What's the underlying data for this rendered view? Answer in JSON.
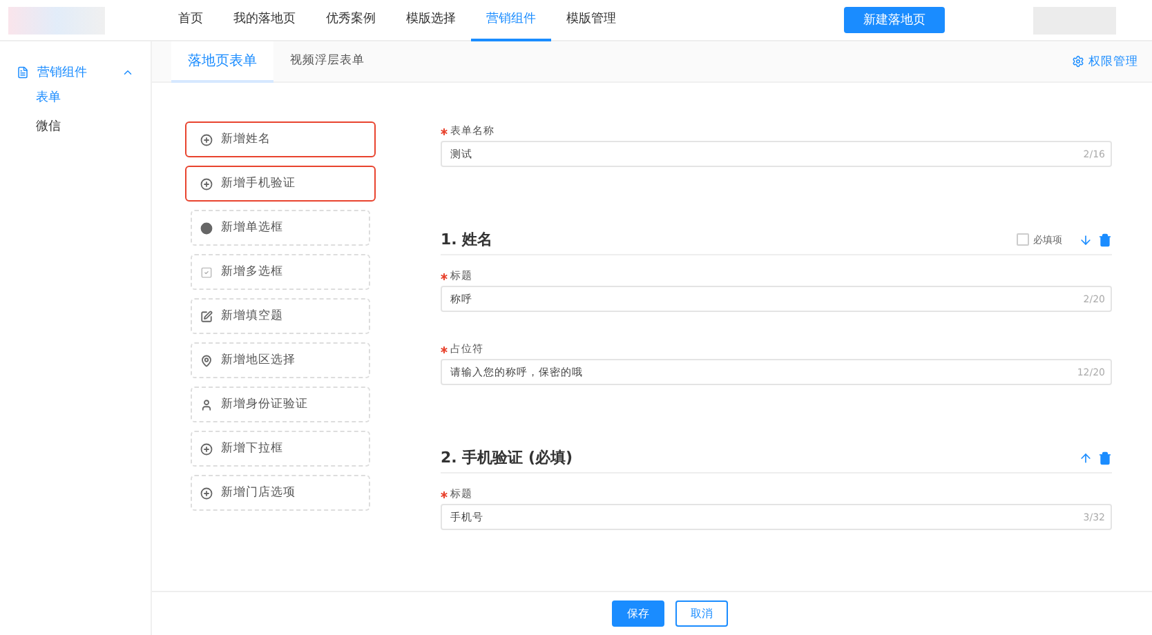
{
  "nav": {
    "items": [
      {
        "label": "首页",
        "selected": false
      },
      {
        "label": "我的落地页",
        "selected": false
      },
      {
        "label": "优秀案例",
        "selected": false
      },
      {
        "label": "模版选择",
        "selected": false
      },
      {
        "label": "营销组件",
        "selected": true
      },
      {
        "label": "模版管理",
        "selected": false
      }
    ],
    "action": "新建落地页"
  },
  "sidebar": {
    "group": {
      "label": "营销组件",
      "expanded": true
    },
    "items": [
      {
        "label": "表单",
        "selected": true
      },
      {
        "label": "微信",
        "selected": false
      }
    ]
  },
  "tabs": [
    {
      "label": "落地页表单",
      "selected": true
    },
    {
      "label": "视频浮层表单",
      "selected": false
    }
  ],
  "permission_link": "权限管理",
  "palette": [
    {
      "kind": "name",
      "label": "新增姓名",
      "highlighted": true
    },
    {
      "kind": "phone",
      "label": "新增手机验证",
      "highlighted": true
    },
    {
      "kind": "radio",
      "label": "新增单选框",
      "highlighted": false
    },
    {
      "kind": "checkbox",
      "label": "新增多选框",
      "highlighted": false
    },
    {
      "kind": "fill",
      "label": "新增填空题",
      "highlighted": false
    },
    {
      "kind": "region",
      "label": "新增地区选择",
      "highlighted": false
    },
    {
      "kind": "id",
      "label": "新增身份证验证",
      "highlighted": false
    },
    {
      "kind": "dropdown",
      "label": "新增下拉框",
      "highlighted": false
    },
    {
      "kind": "store",
      "label": "新增门店选项",
      "highlighted": false
    }
  ],
  "form_name": {
    "label": "表单名称",
    "required": true,
    "value": "测试",
    "counter": "2/16"
  },
  "sections": [
    {
      "title": "1. 姓名",
      "required_option": {
        "label": "必填项",
        "checked": false
      },
      "move_arrow": {
        "kind": "down"
      },
      "fields": [
        {
          "label": "标题",
          "required": true,
          "value": "称呼",
          "counter": "2/20"
        },
        {
          "label": "占位符",
          "required": true,
          "value": "请输入您的称呼，保密的哦",
          "counter": "12/20"
        }
      ]
    },
    {
      "title": "2. 手机验证 (必填)",
      "move_arrow": {
        "kind": "up"
      },
      "fields": [
        {
          "label": "标题",
          "required": true,
          "value": "手机号",
          "counter": "3/32"
        }
      ]
    }
  ],
  "buttons": [
    {
      "kind": "primary",
      "label": "保存"
    },
    {
      "kind": "secondary",
      "label": "取消"
    }
  ]
}
